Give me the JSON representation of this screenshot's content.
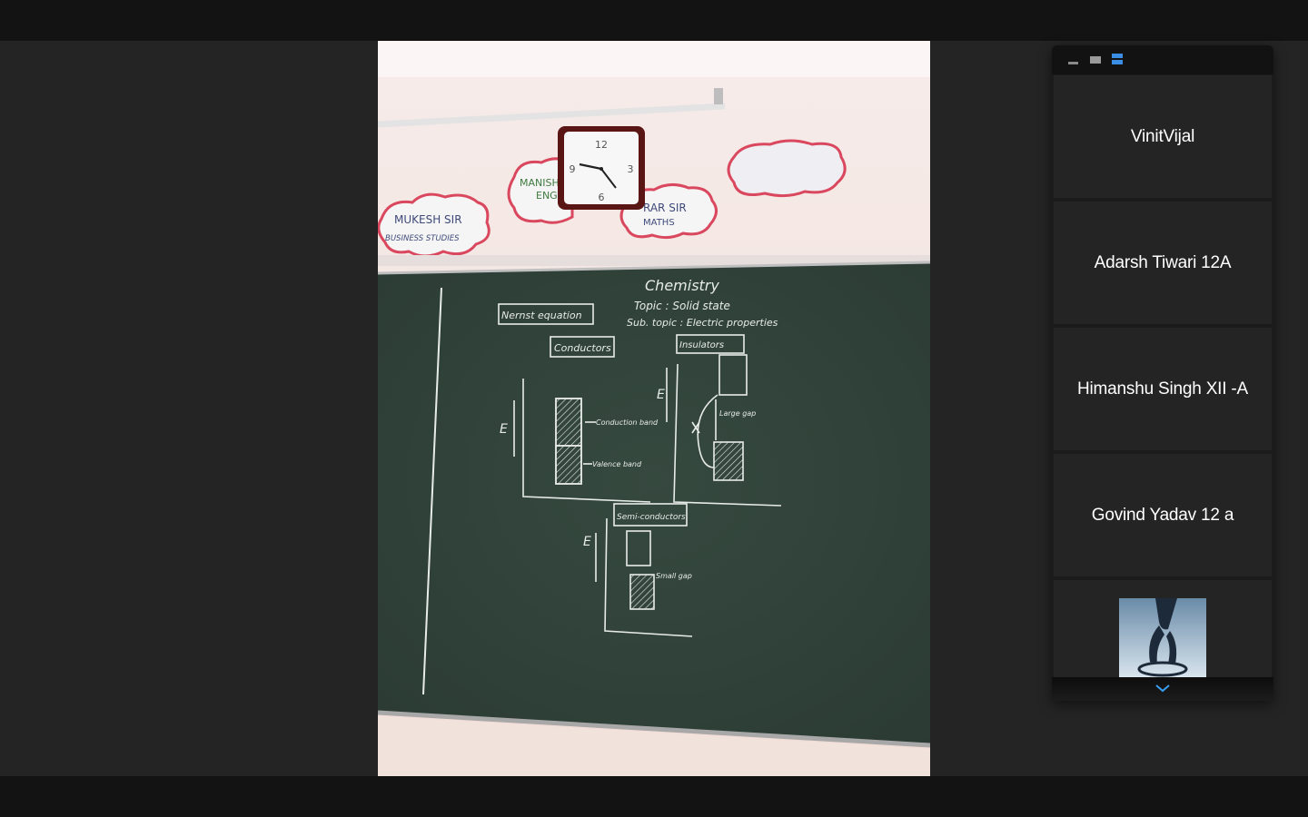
{
  "main_video": {
    "wall_labels": {
      "left_cloud": {
        "line1": "MUKESH SIR",
        "line2": "BUSINESS STUDIES"
      },
      "middle_cloud": {
        "line1": "MANISH",
        "line2": "ENG"
      },
      "right_cloud": {
        "line1": "RAR SIR",
        "line2": "MATHS"
      }
    },
    "board": {
      "subject": "Chemistry",
      "topic": "Topic : Solid state",
      "sub_topic": "Sub. topic : Electric properties",
      "box_nernst": "Nernst equation",
      "box_conductors": "Conductors",
      "box_insulators": "Insulators",
      "box_semiconductors": "Semi-conductors",
      "label_conduction_band": "Conduction band",
      "label_valence_band": "Valence band",
      "label_large_gap": "Large gap",
      "label_small_gap": "Small gap",
      "axis_e": "E"
    }
  },
  "participants_panel": {
    "view_buttons": [
      "minimize-view",
      "strip-view",
      "speaker-view"
    ],
    "participants": [
      {
        "name": "VinitVijal"
      },
      {
        "name": "Adarsh Tiwari 12A"
      },
      {
        "name": "Himanshu Singh XII -A"
      },
      {
        "name": "Govind Yadav 12 a"
      }
    ]
  },
  "colors": {
    "background": "#242424",
    "bars": "#131313",
    "tile": "#242424",
    "accent": "#3a8ee6",
    "chalkboard": "#2c3d35",
    "chalk": "#e8ece9"
  }
}
